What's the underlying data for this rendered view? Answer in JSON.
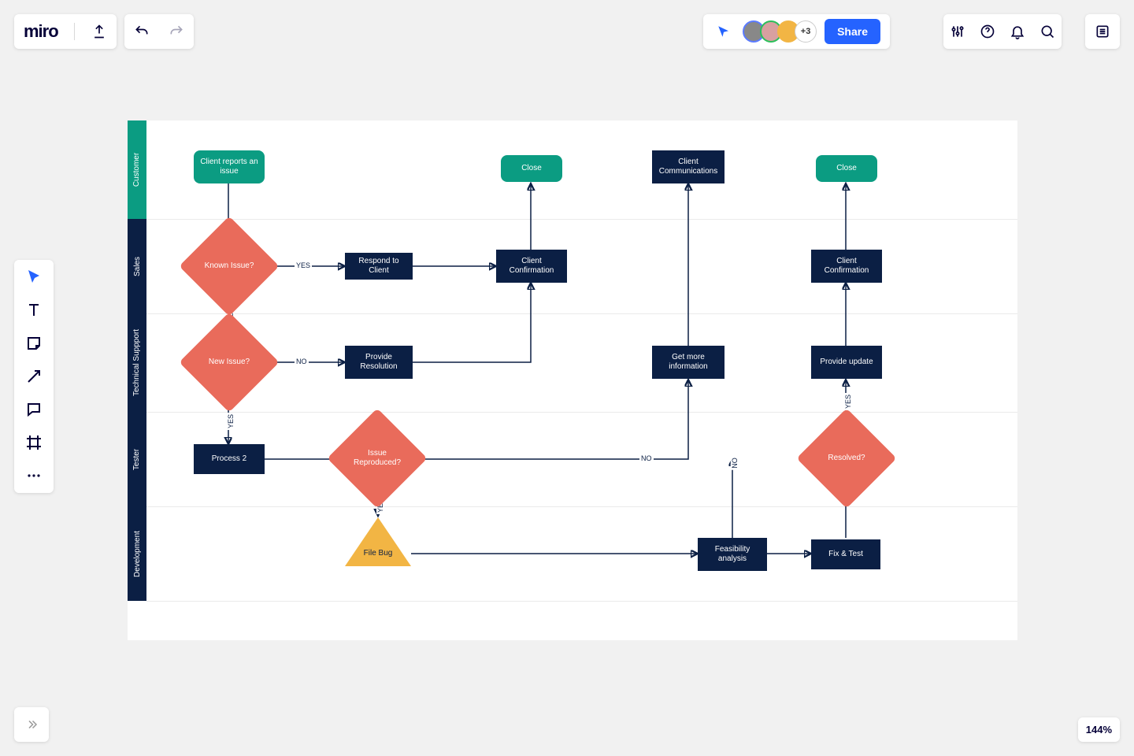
{
  "app": {
    "logo": "miro",
    "share": "Share",
    "extra_collab": "+3",
    "zoom": "144%"
  },
  "toolbar": {
    "undo": "",
    "redo": ""
  },
  "lanes": {
    "customer": "Customer",
    "sales": "Sales",
    "tech": "Technical Suppport",
    "tester": "Tester",
    "dev": "Development"
  },
  "nodes": {
    "report": "Client reports an issue",
    "close1": "Close",
    "comm": "Client Communications",
    "close2": "Close",
    "known": "Known Issue?",
    "respond": "Respond to Client",
    "confirm1": "Client Confirmation",
    "confirm2": "Client Confirmation",
    "newissue": "New Issue?",
    "resolution": "Provide Resolution",
    "moreinfo": "Get more information",
    "update": "Provide update",
    "process2": "Process 2",
    "reproduced": "Issue Reproduced?",
    "resolved": "Resolved?",
    "filebug": "File Bug",
    "feasibility": "Feasibility analysis",
    "fixtest": "Fix & Test"
  },
  "labels": {
    "yes": "YES",
    "no": "NO"
  },
  "chart_data": {
    "type": "swimlane-flowchart",
    "lanes": [
      "Customer",
      "Sales",
      "Technical Suppport",
      "Tester",
      "Development"
    ],
    "nodes": [
      {
        "id": "report",
        "lane": "Customer",
        "shape": "rounded",
        "label": "Client reports an issue"
      },
      {
        "id": "close1",
        "lane": "Customer",
        "shape": "rounded",
        "label": "Close"
      },
      {
        "id": "comm",
        "lane": "Customer",
        "shape": "process",
        "label": "Client Communications"
      },
      {
        "id": "close2",
        "lane": "Customer",
        "shape": "rounded",
        "label": "Close"
      },
      {
        "id": "known",
        "lane": "Sales",
        "shape": "decision",
        "label": "Known Issue?"
      },
      {
        "id": "respond",
        "lane": "Sales",
        "shape": "process",
        "label": "Respond to Client"
      },
      {
        "id": "confirm1",
        "lane": "Sales",
        "shape": "process",
        "label": "Client Confirmation"
      },
      {
        "id": "confirm2",
        "lane": "Sales",
        "shape": "process",
        "label": "Client Confirmation"
      },
      {
        "id": "newissue",
        "lane": "Technical Suppport",
        "shape": "decision",
        "label": "New Issue?"
      },
      {
        "id": "resolution",
        "lane": "Technical Suppport",
        "shape": "process",
        "label": "Provide Resolution"
      },
      {
        "id": "moreinfo",
        "lane": "Technical Suppport",
        "shape": "process",
        "label": "Get more information"
      },
      {
        "id": "update",
        "lane": "Technical Suppport",
        "shape": "process",
        "label": "Provide update"
      },
      {
        "id": "process2",
        "lane": "Tester",
        "shape": "process",
        "label": "Process 2"
      },
      {
        "id": "reproduced",
        "lane": "Tester",
        "shape": "decision",
        "label": "Issue Reproduced?"
      },
      {
        "id": "resolved",
        "lane": "Tester",
        "shape": "decision",
        "label": "Resolved?"
      },
      {
        "id": "filebug",
        "lane": "Development",
        "shape": "triangle",
        "label": "File Bug"
      },
      {
        "id": "feasibility",
        "lane": "Development",
        "shape": "process",
        "label": "Feasibility analysis"
      },
      {
        "id": "fixtest",
        "lane": "Development",
        "shape": "process",
        "label": "Fix & Test"
      }
    ],
    "edges": [
      {
        "from": "report",
        "to": "known"
      },
      {
        "from": "known",
        "to": "respond",
        "label": "YES"
      },
      {
        "from": "known",
        "to": "newissue",
        "label": "NO"
      },
      {
        "from": "respond",
        "to": "confirm1"
      },
      {
        "from": "confirm1",
        "to": "close1"
      },
      {
        "from": "newissue",
        "to": "resolution",
        "label": "NO"
      },
      {
        "from": "resolution",
        "to": "confirm1"
      },
      {
        "from": "newissue",
        "to": "process2",
        "label": "YES"
      },
      {
        "from": "process2",
        "to": "reproduced"
      },
      {
        "from": "reproduced",
        "to": "moreinfo",
        "label": "NO"
      },
      {
        "from": "reproduced",
        "to": "filebug",
        "label": "YES"
      },
      {
        "from": "moreinfo",
        "to": "comm"
      },
      {
        "from": "filebug",
        "to": "feasibility"
      },
      {
        "from": "feasibility",
        "to": "fixtest"
      },
      {
        "from": "feasibility",
        "to": "reproduced_back",
        "label": "NO"
      },
      {
        "from": "fixtest",
        "to": "resolved"
      },
      {
        "from": "resolved",
        "to": "update",
        "label": "YES"
      },
      {
        "from": "resolved",
        "to": "feasibility",
        "label": "NO"
      },
      {
        "from": "update",
        "to": "confirm2"
      },
      {
        "from": "confirm2",
        "to": "close2"
      }
    ]
  }
}
